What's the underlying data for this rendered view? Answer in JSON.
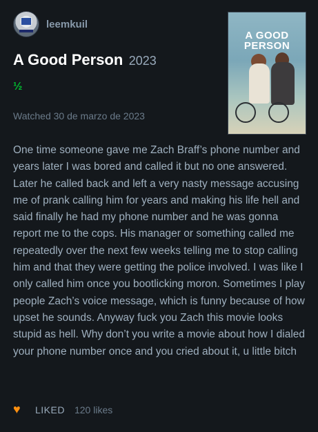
{
  "header": {
    "username": "leemkuil"
  },
  "film": {
    "title": "A Good Person",
    "year": "2023",
    "rating": "½",
    "watched": "Watched 30 de marzo de 2023",
    "poster_title": "A GOOD PERSON"
  },
  "review": {
    "text": "One time someone gave me Zach Braff’s phone number and years later I was bored and called it but no one answered. Later he called back and left a very nasty message accusing me of prank calling him for years and making his life hell and said finally he had my phone number and he was gonna report me to the cops. His manager or something called me repeatedly over the next few weeks telling me to stop calling him and that they were getting the police involved. I was like I only called him once you bootlicking moron. Sometimes I play people Zach’s voice message, which is funny because of how upset he sounds. Anyway fuck you Zach this movie looks stupid as hell. Why don’t you write a movie about how I dialed your phone number once and you cried about it, u little bitch"
  },
  "footer": {
    "liked_label": "LIKED",
    "likes_count": "120 likes"
  },
  "colors": {
    "background": "#14181c",
    "rating_green": "#00c030",
    "heart_orange": "#ff9010"
  },
  "icons": {
    "like": "heart-icon"
  }
}
